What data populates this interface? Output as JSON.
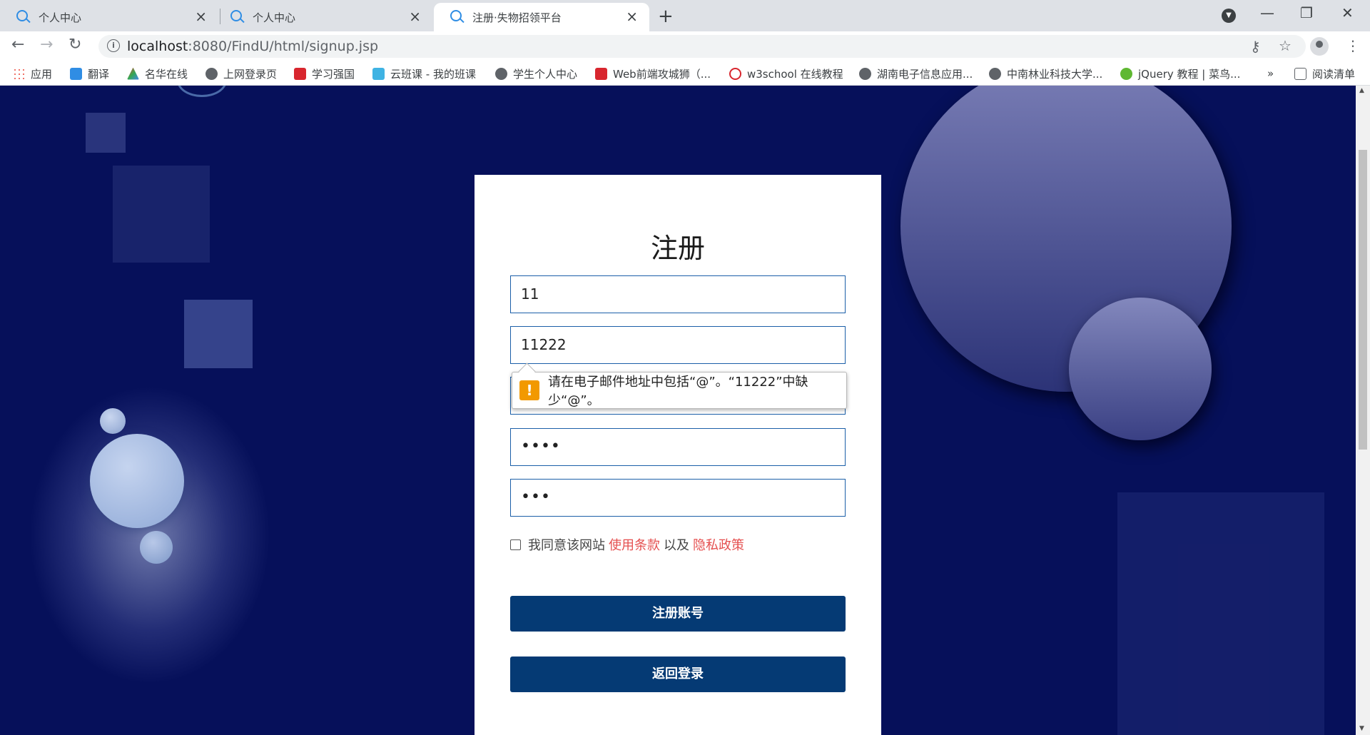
{
  "browser": {
    "tabs": [
      {
        "title": "个人中心",
        "active": false
      },
      {
        "title": "个人中心",
        "active": false
      },
      {
        "title": "注册·失物招领平台",
        "active": true
      }
    ],
    "new_tab_glyph": "+",
    "close_glyph": "×",
    "window_controls": {
      "minimize": "—",
      "restore": "❐",
      "close": "✕"
    },
    "url_host": "localhost",
    "url_rest": ":8080/FindU/html/signup.jsp",
    "nav": {
      "back": "←",
      "forward": "→",
      "reload": "↻"
    },
    "toolbar_icons": [
      "key-icon",
      "star-icon",
      "avatar",
      "menu-icon"
    ]
  },
  "bookmarks": {
    "items": [
      {
        "label": "应用",
        "icon": "grid"
      },
      {
        "label": "翻译",
        "icon": "blue"
      },
      {
        "label": "名华在线",
        "icon": "tri"
      },
      {
        "label": "上网登录页",
        "icon": "globe"
      },
      {
        "label": "学习强国",
        "icon": "red"
      },
      {
        "label": "云班课 - 我的班课",
        "icon": "cloud"
      },
      {
        "label": "学生个人中心",
        "icon": "globe"
      },
      {
        "label": "Web前端攻城狮（...",
        "icon": "red"
      },
      {
        "label": "w3school 在线教程",
        "icon": "w3"
      },
      {
        "label": "湖南电子信息应用...",
        "icon": "globe"
      },
      {
        "label": "中南林业科技大学...",
        "icon": "globe"
      },
      {
        "label": "jQuery 教程 | 菜鸟...",
        "icon": "jq"
      }
    ],
    "overflow": "»",
    "reading_list": "阅读清单"
  },
  "form": {
    "title": "注册",
    "fields": [
      {
        "value": "11",
        "type": "text"
      },
      {
        "value": "11222",
        "type": "email"
      },
      {
        "value": "",
        "type": "text"
      },
      {
        "value": "••••",
        "type": "password"
      },
      {
        "value": "•••",
        "type": "password"
      }
    ],
    "validation_message": "请在电子邮件地址中包括“@”。“11222”中缺少“@”。",
    "warning_glyph": "!",
    "agree_prefix": "我同意该网站",
    "terms_link": "使用条款",
    "agree_middle": "以及",
    "privacy_link": "隐私政策",
    "agree_checked": false,
    "register_button": "注册账号",
    "back_button": "返回登录"
  },
  "colors": {
    "page_bg": "#06105a",
    "button_bg": "#053a74",
    "link": "#e55050",
    "field_border": "#1b5fa8",
    "warning": "#f29900"
  }
}
